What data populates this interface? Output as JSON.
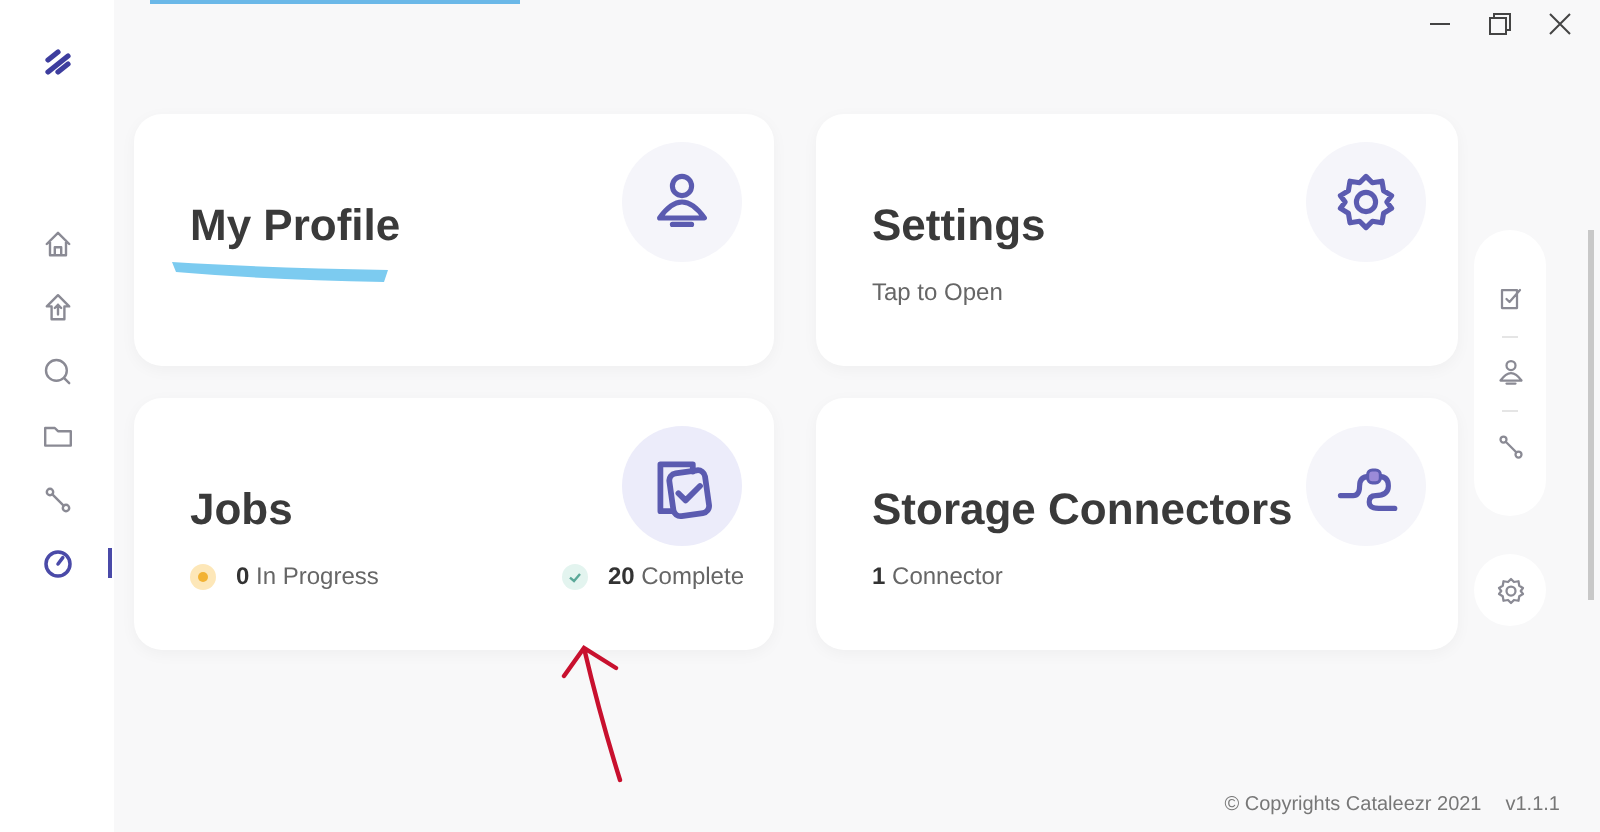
{
  "sidebar": {
    "items": [
      {
        "kind": "home",
        "selected": false
      },
      {
        "kind": "upload",
        "selected": false
      },
      {
        "kind": "search",
        "selected": false
      },
      {
        "kind": "folder",
        "selected": false
      },
      {
        "kind": "route",
        "selected": false
      },
      {
        "kind": "dashboard",
        "selected": true
      }
    ]
  },
  "cards": [
    {
      "kind": "profile",
      "title": "My Profile",
      "redacted_subtitle": true
    },
    {
      "kind": "settings",
      "title": "Settings",
      "subtitle": "Tap to Open"
    },
    {
      "kind": "jobs",
      "title": "Jobs",
      "stats": [
        {
          "kind": "progress",
          "count": "0",
          "label": "In Progress"
        },
        {
          "kind": "complete",
          "count": "20",
          "label": "Complete"
        }
      ]
    },
    {
      "kind": "connectors",
      "title": "Storage Connectors",
      "count": "1",
      "label": "Connector"
    }
  ],
  "rail": {
    "items": [
      {
        "kind": "tasks"
      },
      {
        "kind": "profile"
      },
      {
        "kind": "route"
      }
    ],
    "bottom": {
      "kind": "settings"
    }
  },
  "footer": {
    "copyright": "© Copyrights Cataleezr 2021",
    "version": "v1.1.1"
  },
  "annotation_arrow": true
}
